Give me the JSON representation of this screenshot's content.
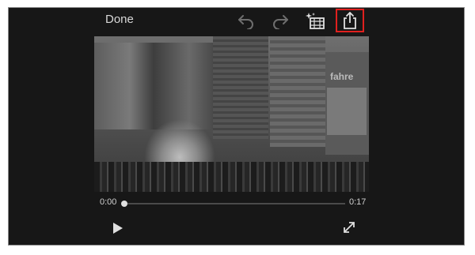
{
  "toolbar": {
    "done_label": "Done",
    "icons": [
      "undo-icon",
      "redo-icon",
      "effects-icon",
      "share-icon"
    ],
    "highlight_color": "#e0201e"
  },
  "video": {
    "sign_text": "fahre"
  },
  "playback": {
    "current_time": "0:00",
    "duration": "0:17",
    "progress": 0.0
  },
  "controls": {
    "icons": [
      "play-icon",
      "fullscreen-icon"
    ]
  }
}
